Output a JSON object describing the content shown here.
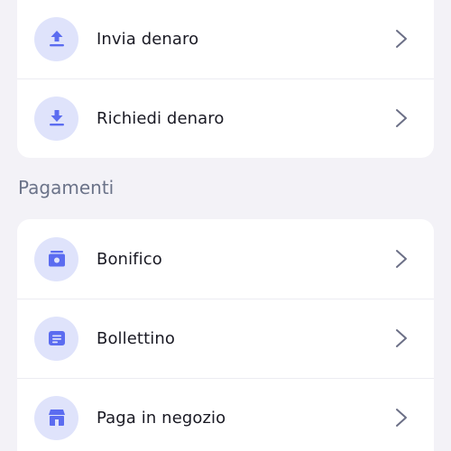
{
  "colors": {
    "background": "#f3f2f7",
    "card": "#ffffff",
    "icon_bg": "#dfe3fb",
    "icon_fg": "#5b6cf0",
    "chevron": "#6b6f86",
    "section_title": "#6b7389"
  },
  "transfers": {
    "items": [
      {
        "label": "Invia denaro",
        "icon": "upload-icon"
      },
      {
        "label": "Richiedi denaro",
        "icon": "download-icon"
      }
    ]
  },
  "payments": {
    "title": "Pagamenti",
    "items": [
      {
        "label": "Bonifico",
        "icon": "bank-transfer-icon"
      },
      {
        "label": "Bollettino",
        "icon": "payment-slip-icon"
      },
      {
        "label": "Paga in negozio",
        "icon": "store-icon"
      }
    ]
  }
}
